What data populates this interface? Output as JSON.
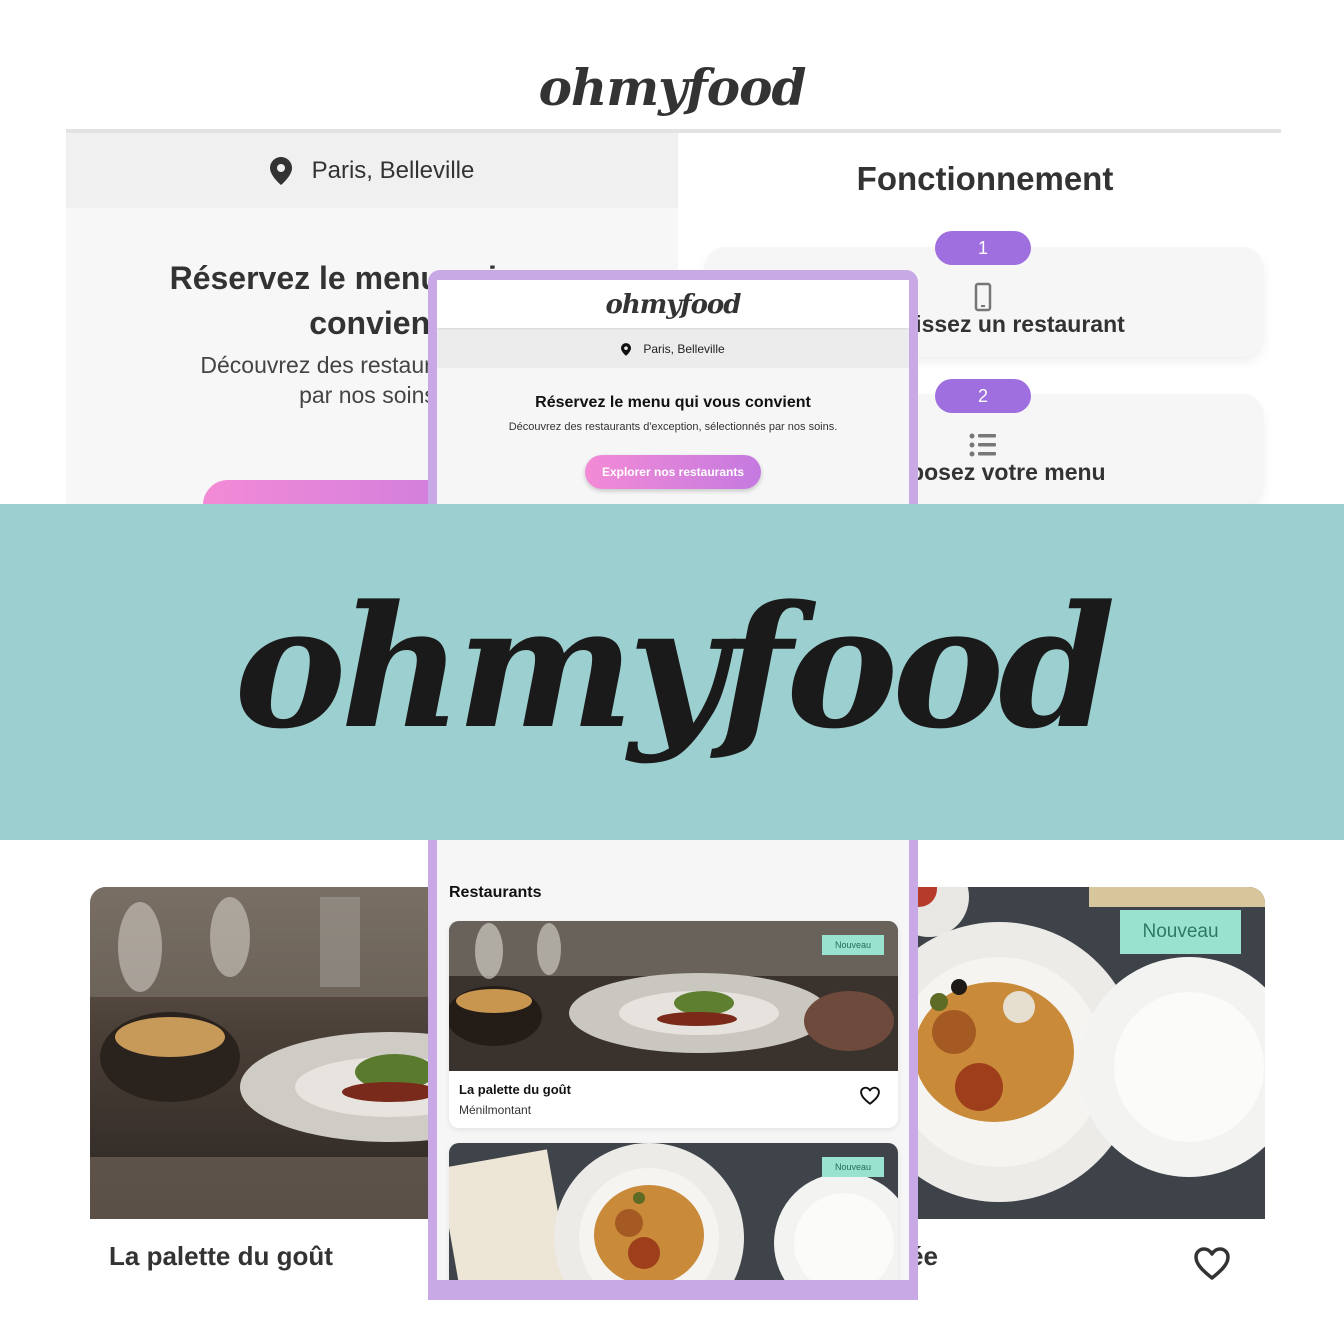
{
  "brand": {
    "logo_text": "ohmyfood"
  },
  "desktop": {
    "location": {
      "icon": "map-pin-icon",
      "text": "Paris, Belleville"
    },
    "hero": {
      "title_line1": "Réservez le menu qui vous",
      "title_line2": "convient",
      "subtitle_line1": "Découvrez des restaurants d'exc",
      "subtitle_line2": "par nos soins"
    },
    "how_it_works": {
      "title": "Fonctionnement",
      "steps": [
        {
          "number": "1",
          "icon": "smartphone-icon",
          "label": "isissez un restaurant"
        },
        {
          "number": "2",
          "icon": "list-icon",
          "label": "nposez votre menu"
        }
      ]
    },
    "cards": [
      {
        "name": "La palette du goût"
      },
      {
        "name": "ée",
        "badge": "Nouveau",
        "icon": "heart-icon"
      }
    ]
  },
  "mobile": {
    "logo_text": "ohmyfood",
    "location": {
      "icon": "map-pin-icon",
      "text": "Paris, Belleville"
    },
    "hero": {
      "title": "Réservez le menu qui vous convient",
      "subtitle": "Découvrez des restaurants d'exception, sélectionnés par nos soins.",
      "cta_label": "Explorer nos restaurants"
    },
    "restaurants": {
      "title": "Restaurants",
      "items": [
        {
          "badge": "Nouveau",
          "name": "La palette du goût",
          "area": "Ménilmontant",
          "icon": "heart-icon"
        },
        {
          "badge": "Nouveau"
        }
      ]
    }
  },
  "banner": {
    "logo_text": "ohmyfood",
    "background": "#9ccfcf"
  },
  "colors": {
    "accent_purple": "#9f6fe0",
    "gradient_pink": "#f38ad6",
    "badge_mint": "#99e2d0",
    "frame": "#c8a9e6"
  }
}
